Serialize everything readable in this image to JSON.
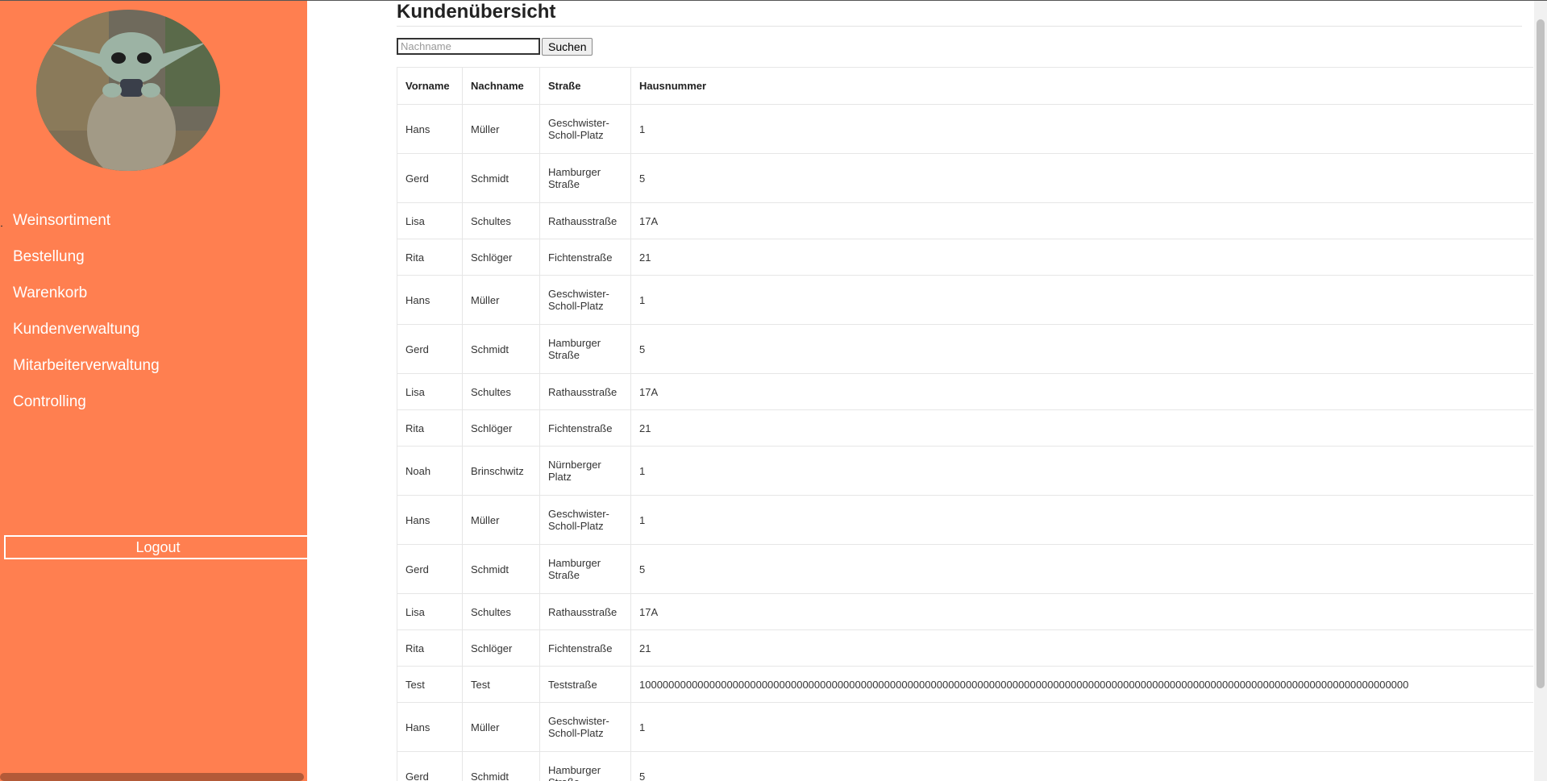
{
  "sidebar": {
    "nav_items": [
      {
        "label": "Weinsortiment"
      },
      {
        "label": "Bestellung"
      },
      {
        "label": "Warenkorb"
      },
      {
        "label": "Kundenverwaltung"
      },
      {
        "label": "Mitarbeiterverwaltung"
      },
      {
        "label": "Controlling"
      }
    ],
    "logout_label": "Logout",
    "accent_color": "#ff7f50"
  },
  "main": {
    "title": "Kundenübersicht",
    "search": {
      "placeholder": "Nachname",
      "button_label": "Suchen"
    },
    "table": {
      "headers": [
        "Vorname",
        "Nachname",
        "Straße",
        "Hausnummer"
      ],
      "rows": [
        [
          "Hans",
          "Müller",
          "Geschwister-Scholl-Platz",
          "1"
        ],
        [
          "Gerd",
          "Schmidt",
          "Hamburger Straße",
          "5"
        ],
        [
          "Lisa",
          "Schultes",
          "Rathausstraße",
          "17A"
        ],
        [
          "Rita",
          "Schlöger",
          "Fichtenstraße",
          "21"
        ],
        [
          "Hans",
          "Müller",
          "Geschwister-Scholl-Platz",
          "1"
        ],
        [
          "Gerd",
          "Schmidt",
          "Hamburger Straße",
          "5"
        ],
        [
          "Lisa",
          "Schultes",
          "Rathausstraße",
          "17A"
        ],
        [
          "Rita",
          "Schlöger",
          "Fichtenstraße",
          "21"
        ],
        [
          "Noah",
          "Brinschwitz",
          "Nürnberger Platz",
          "1"
        ],
        [
          "Hans",
          "Müller",
          "Geschwister-Scholl-Platz",
          "1"
        ],
        [
          "Gerd",
          "Schmidt",
          "Hamburger Straße",
          "5"
        ],
        [
          "Lisa",
          "Schultes",
          "Rathausstraße",
          "17A"
        ],
        [
          "Rita",
          "Schlöger",
          "Fichtenstraße",
          "21"
        ],
        [
          "Test",
          "Test",
          "Teststraße",
          "100000000000000000000000000000000000000000000000000000000000000000000000000000000000000000000000000000000000000000000000000000000000"
        ],
        [
          "Hans",
          "Müller",
          "Geschwister-Scholl-Platz",
          "1"
        ],
        [
          "Gerd",
          "Schmidt",
          "Hamburger Straße",
          "5"
        ]
      ]
    }
  }
}
